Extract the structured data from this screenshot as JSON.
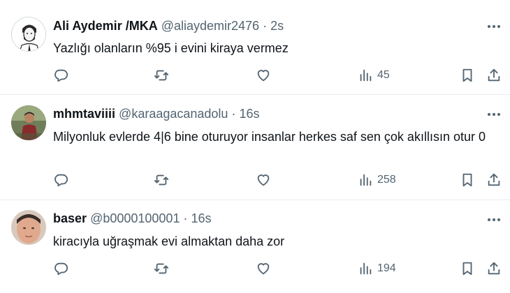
{
  "tweets": [
    {
      "name": "Ali Aydemir /MKA",
      "handle": "@aliaydemir2476",
      "time": "2s",
      "text": "Yazlığı olanların %95 i evini kiraya vermez",
      "views": "45",
      "avatar": "illustrated-man-avatar"
    },
    {
      "name": "mhmtaviiii",
      "handle": "@karaagacanadolu",
      "time": "16s",
      "text": "Milyonluk evlerde 4|6 bine oturuyor insanlar herkes saf sen çok akıllısın otur 0",
      "views": "258",
      "avatar": "outdoor-person-avatar"
    },
    {
      "name": "baser",
      "handle": "@b0000100001",
      "time": "16s",
      "text": "kiracıyla uğraşmak evi almaktan daha zor",
      "views": "194",
      "avatar": "face-photo-avatar"
    }
  ],
  "separator": "·",
  "icons": {
    "reply": "reply-icon",
    "retweet": "retweet-icon",
    "like": "heart-icon",
    "views": "views-icon",
    "bookmark": "bookmark-icon",
    "share": "share-icon",
    "more": "more-icon"
  },
  "colors": {
    "text": "#0f1419",
    "secondary": "#536471",
    "divider": "#e6ecf0"
  }
}
